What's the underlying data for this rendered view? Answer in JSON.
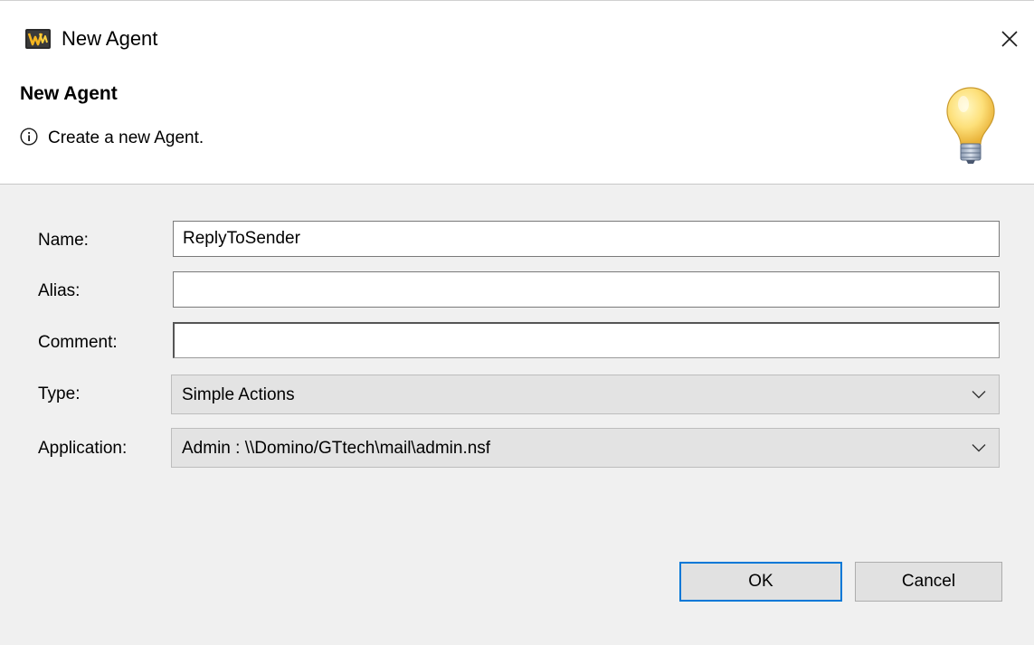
{
  "window": {
    "title": "New Agent",
    "close_icon": "close-icon",
    "app_icon": "domino-designer-icon"
  },
  "header": {
    "title": "New Agent",
    "message": "Create a new Agent.",
    "message_icon": "info-icon",
    "banner_icon": "lightbulb-icon"
  },
  "form": {
    "name": {
      "label": "Name:",
      "value": "ReplyToSender"
    },
    "alias": {
      "label": "Alias:",
      "value": ""
    },
    "comment": {
      "label": "Comment:",
      "value": ""
    },
    "type": {
      "label": "Type:",
      "selected": "Simple Actions"
    },
    "application": {
      "label": "Application:",
      "selected": "Admin : \\\\Domino/GTtech\\mail\\admin.nsf"
    }
  },
  "buttons": {
    "ok": "OK",
    "cancel": "Cancel"
  },
  "colors": {
    "accent": "#0078d7",
    "body_bg": "#f0f0f0",
    "select_bg": "#e3e3e3",
    "button_bg": "#e1e1e1"
  }
}
